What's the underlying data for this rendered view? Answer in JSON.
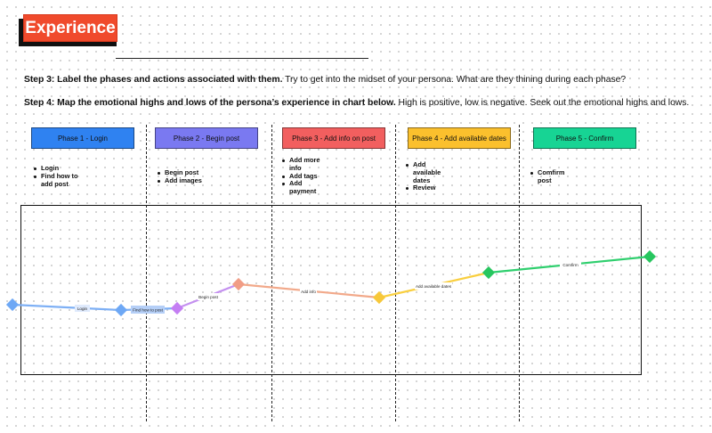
{
  "header": {
    "badge": "Experience"
  },
  "steps": {
    "step3_bold": "Step 3: Label the phases and actions associated with them.",
    "step3_rest": " Try to get into the midset of your persona. What are they thining during each phase?",
    "step4_bold": "Step 4: Map the emotional highs and lows of the persona’s experience in chart below.",
    "step4_rest": " High is positive, low is negative. Seek out the emotional highs and lows."
  },
  "phases": [
    {
      "label": "Phase 1 - Login",
      "color": "#2f82f1",
      "actions": [
        "Login",
        "Find how to add post"
      ]
    },
    {
      "label": "Phase 2 - Begin post",
      "color": "#7a79f1",
      "actions": [
        "Begin post",
        "Add images"
      ]
    },
    {
      "label": "Phase 3 - Add info on post",
      "color": "#f25f5f",
      "actions": [
        "Add more info",
        "Add tags",
        "Add payment"
      ]
    },
    {
      "label": "Phase 4 - Add available dates",
      "color": "#fbc02d",
      "actions": [
        "Add available dates",
        "Review"
      ]
    },
    {
      "label": "Phase 5 - Confirm",
      "color": "#17d494",
      "actions": [
        "Comfirm post"
      ]
    }
  ],
  "journey_labels": {
    "login": "Login",
    "find_how": "Find how to post",
    "begin_post": "Begin post",
    "add_info": "Add info",
    "add_dates": "Add available dates",
    "confirm": "Comfirm"
  },
  "colors": {
    "login_line": "#7eb0f5",
    "begin_line": "#c490f0",
    "info_line": "#f2a98a",
    "dates_line": "#f9cf3f",
    "confirm_line": "#2fcf6e",
    "blue_marker": "#6ea8f5",
    "purple_marker": "#c47ef3",
    "orange_marker": "#f19d86",
    "yellow_marker": "#f7c83a",
    "green_marker": "#27c65f"
  }
}
